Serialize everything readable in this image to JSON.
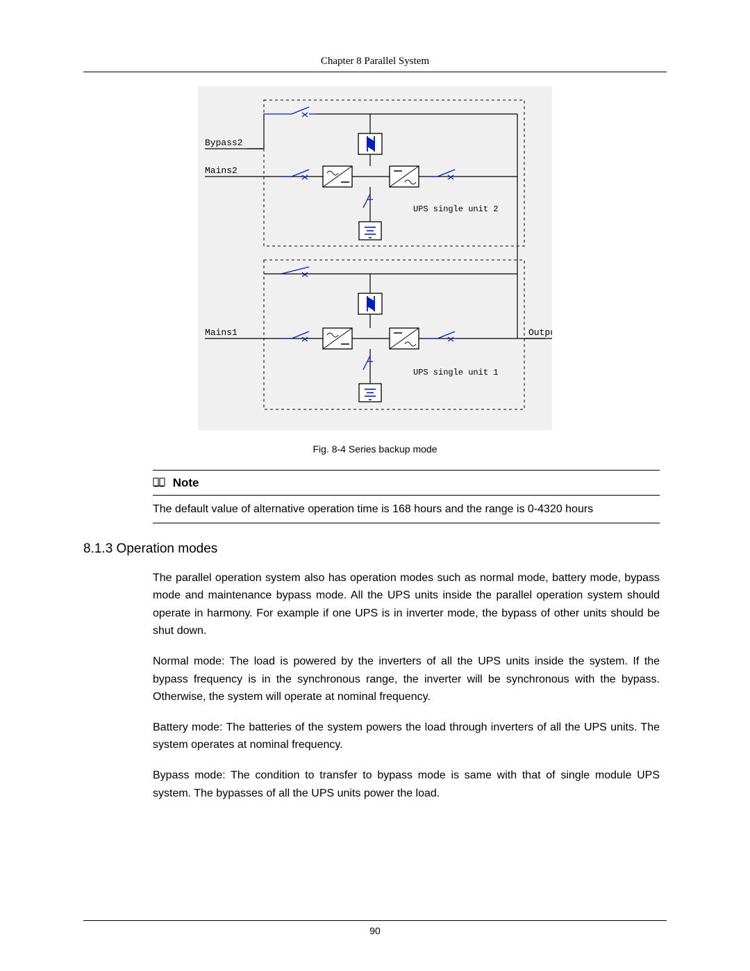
{
  "header": {
    "chapter": "Chapter 8  Parallel System"
  },
  "figure": {
    "caption": "Fig. 8-4 Series backup mode",
    "labels": {
      "bypass2": "Bypass2",
      "mains2": "Mains2",
      "mains1": "Mains1",
      "output": "Output",
      "ups2": "UPS single unit 2",
      "ups1": "UPS single unit 1"
    }
  },
  "note": {
    "title": "Note",
    "body": "The default value of alternative operation time is 168 hours and the range is 0-4320 hours"
  },
  "section": {
    "heading": "8.1.3  Operation modes",
    "paragraphs": [
      "The parallel operation system also has operation modes such as normal mode, battery mode, bypass mode and maintenance bypass mode. All the UPS units inside the parallel operation system should operate in harmony. For example if one UPS is in inverter mode, the bypass of other units should be shut down.",
      "Normal mode: The load is powered by the inverters of all the UPS units inside the system. If the bypass frequency is in the synchronous range, the inverter will be synchronous with the bypass. Otherwise, the system will operate at nominal frequency.",
      "Battery mode: The batteries of the system powers the load through inverters of all the UPS units. The system operates at nominal frequency.",
      "Bypass mode: The condition to transfer to bypass mode is same with that of single module UPS system. The bypasses of all the UPS units power the load."
    ]
  },
  "footer": {
    "page_number": "90"
  }
}
